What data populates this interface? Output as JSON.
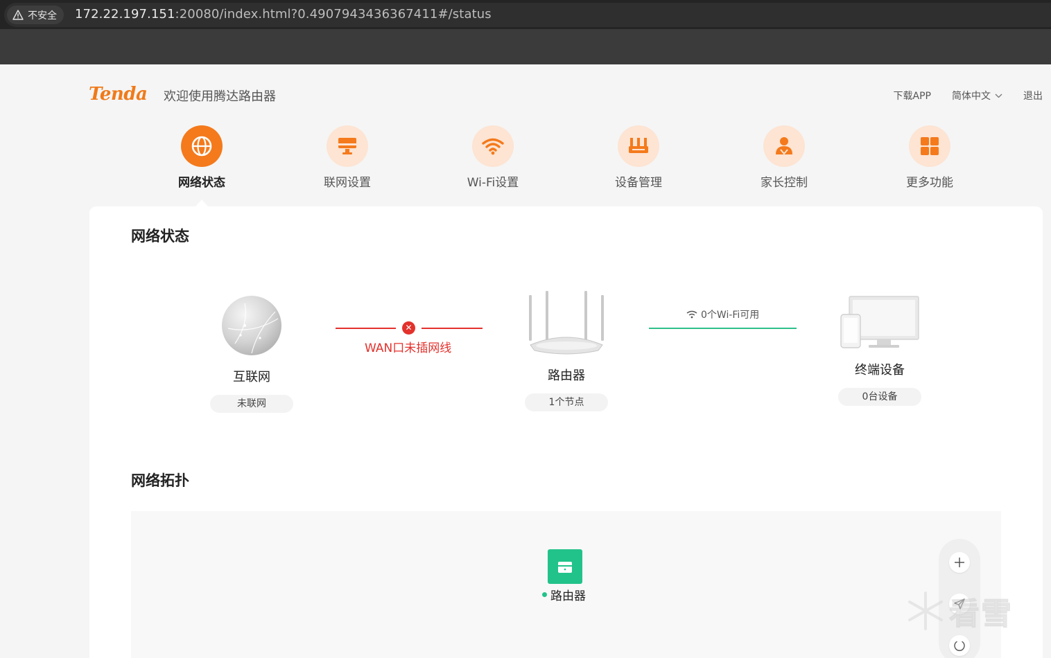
{
  "browser": {
    "security_label": "不安全",
    "url_host": "172.22.197.151",
    "url_rest": ":20080/index.html?0.4907943436367411#/status"
  },
  "header": {
    "logo": "Tenda",
    "welcome": "欢迎使用腾达路由器",
    "download_app": "下载APP",
    "language": "简体中文",
    "logout": "退出"
  },
  "tabs": [
    {
      "label": "网络状态",
      "icon": "globe-icon",
      "active": true
    },
    {
      "label": "联网设置",
      "icon": "monitor-icon",
      "active": false
    },
    {
      "label": "Wi-Fi设置",
      "icon": "wifi-icon",
      "active": false
    },
    {
      "label": "设备管理",
      "icon": "router-device-icon",
      "active": false
    },
    {
      "label": "家长控制",
      "icon": "parent-icon",
      "active": false
    },
    {
      "label": "更多功能",
      "icon": "grid-icon",
      "active": false
    }
  ],
  "status": {
    "title": "网络状态",
    "internet": {
      "name": "互联网",
      "status": "未联网"
    },
    "wan_error": "WAN口未插网线",
    "router": {
      "name": "路由器",
      "status": "1个节点"
    },
    "wifi_available": "0个Wi-Fi可用",
    "terminal": {
      "name": "终端设备",
      "status": "0台设备"
    }
  },
  "topology": {
    "title": "网络拓扑",
    "router_label": "路由器",
    "tools": [
      "plus-icon",
      "send-icon",
      "refresh-icon"
    ]
  },
  "watermark": "看雪",
  "colors": {
    "accent": "#f47a1c",
    "accent_light": "#fde4d3",
    "error": "#e3312c",
    "ok": "#22c38a"
  }
}
